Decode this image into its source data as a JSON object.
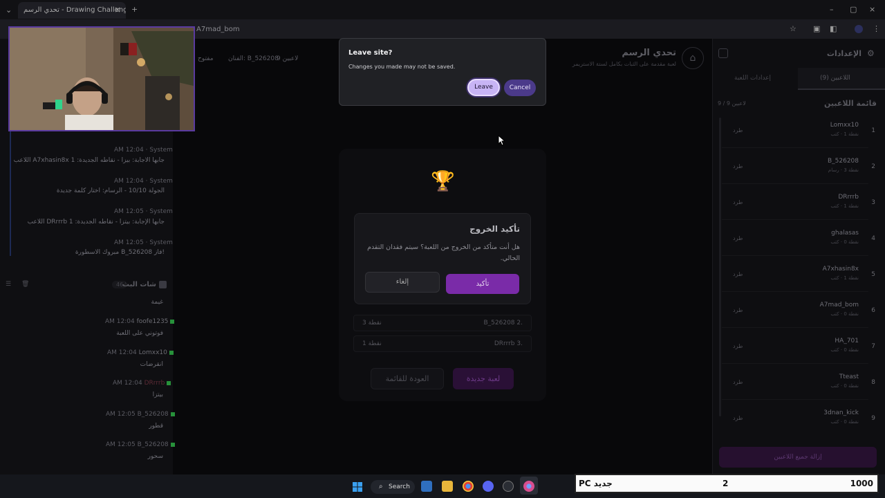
{
  "browser": {
    "tab_title": "تحدي الرسم - Drawing Challenge",
    "url": "A7mad_bom"
  },
  "header": {
    "title": "تحدي الرسم",
    "subtitle": "لعبة مقدمة على الثبات بكامل لستة الاستريمر",
    "players_count": "9 لاعبين",
    "drawer": "الفنان: B_526208",
    "open_label": "مفتوح"
  },
  "leave_dialog": {
    "title": "Leave site?",
    "message": "Changes you made may not be saved.",
    "leave_label": "Leave",
    "cancel_label": "Cancel"
  },
  "confirm_dialog": {
    "title": "تأكيد الخروج",
    "message": "هل أنت متأكد من الخروج من اللعبة؟ سيتم فقدان التقدم الحالي.",
    "confirm_label": "تأكيد",
    "cancel_label": "إلغاء"
  },
  "results": {
    "rows": [
      {
        "rank": "2.",
        "player": "B_526208",
        "score": "3 نقطة"
      },
      {
        "rank": "3.",
        "player": "DRrrrb",
        "score": "1 نقطة"
      }
    ],
    "new_game_label": "لعبة جديدة",
    "back_label": "العودة للقائمة"
  },
  "system_log": [
    {
      "time": "AM 12:04",
      "author": "System",
      "text": "اللاعب A7xhasin8x جابها الاجابة: بيزا - نقاطه الجديدة: 1"
    },
    {
      "time": "AM 12:04",
      "author": "System",
      "text": "الجولة 10/10 - الرسام: اختار كلمة جديدة"
    },
    {
      "time": "AM 12:05",
      "author": "System",
      "text": "اللاعب DRrrrb جابها الإجابة: بيتزا - نقاطه الجديدة: 1"
    },
    {
      "time": "AM 12:05",
      "author": "System",
      "text": "مبروك الاسطورة B_526208 فاز!"
    }
  ],
  "chat": {
    "title": "شات البث",
    "count": "46",
    "messages": [
      {
        "author": "",
        "time": "",
        "text": "غيمة"
      },
      {
        "author": "foofe1235",
        "time": "AM 12:04",
        "text": "فوتوني على اللعبة"
      },
      {
        "author": "Lomxx10",
        "time": "AM 12:04",
        "text": "انقرضات"
      },
      {
        "author": "DRrrrb",
        "time": "AM 12:04",
        "text": "بيتزا"
      },
      {
        "author": "B_526208",
        "time": "AM 12:05",
        "text": "قطور"
      },
      {
        "author": "B_526208",
        "time": "AM 12:05",
        "text": "سحور"
      }
    ]
  },
  "settings": {
    "title": "الإعدادات",
    "tab_players": "اللاعبين (9)",
    "tab_game": "إعدادات اللعبة",
    "list_title": "قائمة اللاعبين",
    "list_count": "9 / 9 لاعبين",
    "kick_label": "طرد",
    "remove_all_label": "إزالة جميع اللاعبين",
    "players": [
      {
        "num": "1",
        "name": "Lomxx10",
        "meta": "نقطة 1 · كتب"
      },
      {
        "num": "2",
        "name": "B_526208",
        "meta": "نقطة 3 · رسام"
      },
      {
        "num": "3",
        "name": "DRrrrb",
        "meta": "نقطة 1 · كتب"
      },
      {
        "num": "4",
        "name": "ghalasas",
        "meta": "نقطة 0 · كتب"
      },
      {
        "num": "5",
        "name": "A7xhasin8x",
        "meta": "نقطة 1 · كتب"
      },
      {
        "num": "6",
        "name": "A7mad_bom",
        "meta": "نقطة 0 · كتب"
      },
      {
        "num": "7",
        "name": "HA_701",
        "meta": "نقطة 0 · كتب"
      },
      {
        "num": "8",
        "name": "Tteast",
        "meta": "نقطة 0 · كتب"
      },
      {
        "num": "9",
        "name": "3dnan_kick",
        "meta": "نقطة 0 · كتب"
      }
    ]
  },
  "taskbar": {
    "search_label": "Search"
  },
  "overlay_score": {
    "label": "PC جديد",
    "middle": "2",
    "right": "1000"
  }
}
